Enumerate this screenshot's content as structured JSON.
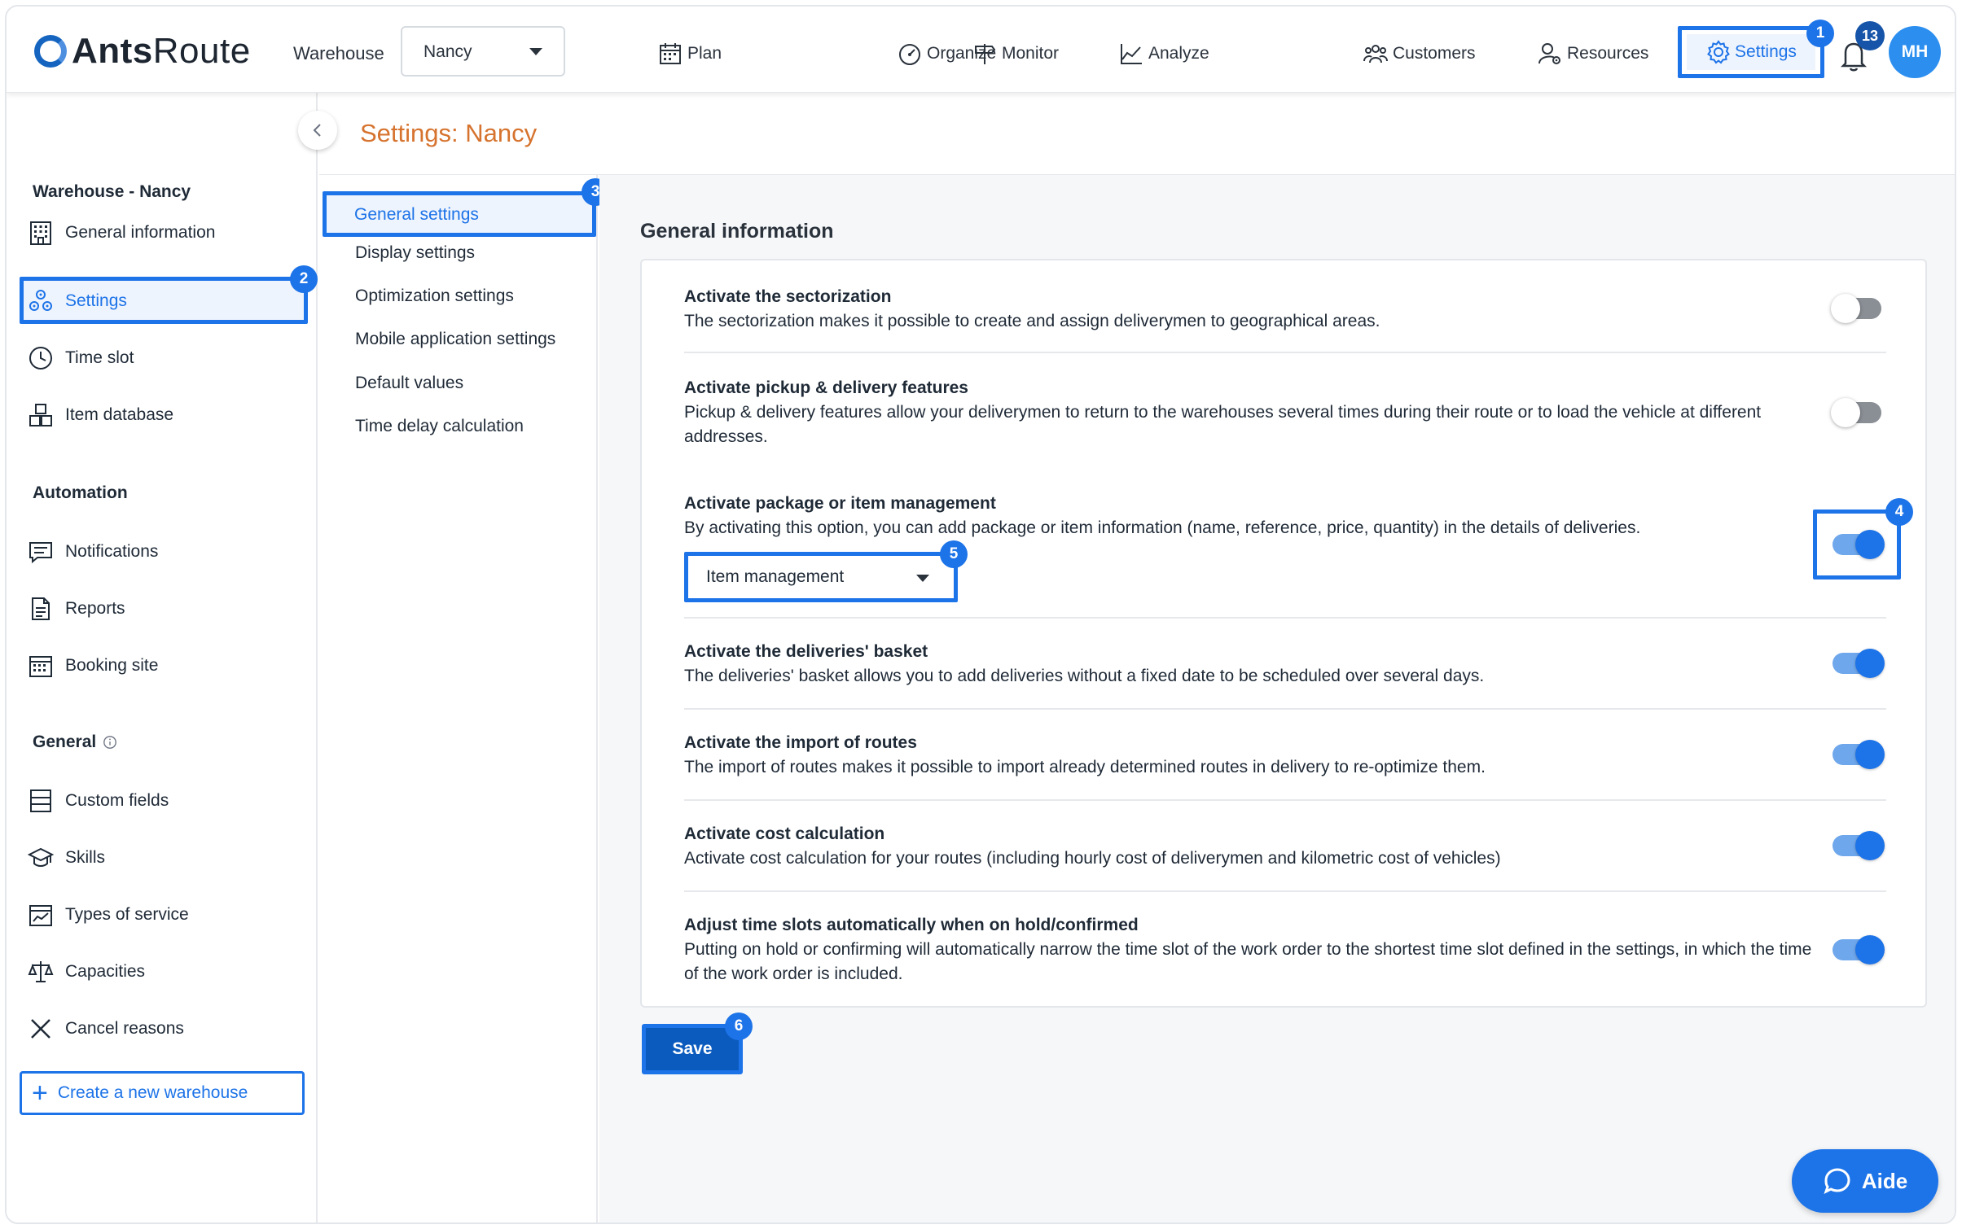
{
  "header": {
    "logo": {
      "bold": "Ants",
      "thin": "Route"
    },
    "warehouse_label": "Warehouse",
    "warehouse_value": "Nancy",
    "nav": [
      {
        "label": "Plan",
        "icon": "calendar-icon"
      },
      {
        "label": "Organize",
        "icon": "gauge-icon"
      },
      {
        "label": "Monitor",
        "icon": "signpost-icon"
      },
      {
        "label": "Analyze",
        "icon": "chart-icon"
      },
      {
        "label": "Customers",
        "icon": "people-icon"
      },
      {
        "label": "Resources",
        "icon": "user-gear-icon"
      }
    ],
    "settings_label": "Settings",
    "notification_count": "13",
    "avatar_initials": "MH"
  },
  "annotations": [
    "1",
    "2",
    "3",
    "4",
    "5",
    "6"
  ],
  "page_title": "Settings: Nancy",
  "sidebar": {
    "warehouse_title": "Warehouse - Nancy",
    "warehouse_items": [
      "General information",
      "Settings",
      "Time slot",
      "Item database"
    ],
    "automation_title": "Automation",
    "automation_items": [
      "Notifications",
      "Reports",
      "Booking site"
    ],
    "general_title": "General",
    "general_items": [
      "Custom fields",
      "Skills",
      "Types of service",
      "Capacities",
      "Cancel reasons"
    ],
    "create_label": "Create a new warehouse"
  },
  "subnav": [
    "General settings",
    "Display settings",
    "Optimization settings",
    "Mobile application settings",
    "Default values",
    "Time delay calculation"
  ],
  "main": {
    "section_title": "General information",
    "options": [
      {
        "title": "Activate the sectorization",
        "desc": "The sectorization makes it possible to create and assign deliverymen to geographical areas.",
        "enabled": false
      },
      {
        "title": "Activate pickup & delivery features",
        "desc": "Pickup & delivery features allow your deliverymen to return to the warehouses several times during their route or to load the vehicle at different addresses.",
        "enabled": false
      },
      {
        "title": "Activate package or item management",
        "desc": "By activating this option, you can add package or item information (name, reference, price, quantity) in the details of deliveries.",
        "enabled": true
      },
      {
        "title": "Activate the deliveries' basket",
        "desc": "The deliveries' basket allows you to add deliveries without a fixed date to be scheduled over several days.",
        "enabled": true
      },
      {
        "title": "Activate the import of routes",
        "desc": "The import of routes makes it possible to import already determined routes in delivery to re-optimize them.",
        "enabled": true
      },
      {
        "title": "Activate cost calculation",
        "desc": "Activate cost calculation for your routes (including hourly cost of deliverymen and kilometric cost of vehicles)",
        "enabled": true
      },
      {
        "title": "Adjust time slots automatically when on hold/confirmed",
        "desc": "Putting on hold or confirming will automatically narrow the time slot of the work order to the shortest time slot defined in the settings, in which the time of the work order is included.",
        "enabled": true
      }
    ],
    "management_select": "Item management",
    "save_label": "Save"
  },
  "help_label": "Aide",
  "colors": {
    "accent": "#1d73e8",
    "title_orange": "#d6732e",
    "save_blue": "#0b5bbf"
  }
}
